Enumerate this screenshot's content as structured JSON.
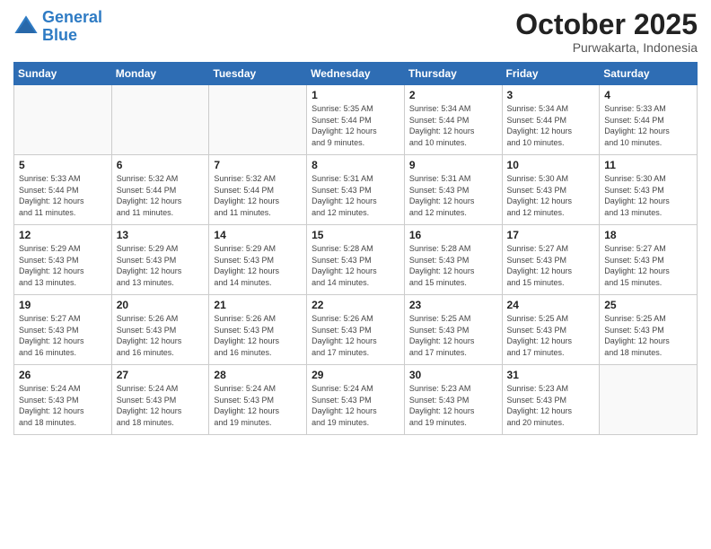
{
  "header": {
    "logo_line1": "General",
    "logo_line2": "Blue",
    "month": "October 2025",
    "location": "Purwakarta, Indonesia"
  },
  "weekdays": [
    "Sunday",
    "Monday",
    "Tuesday",
    "Wednesday",
    "Thursday",
    "Friday",
    "Saturday"
  ],
  "weeks": [
    [
      {
        "day": "",
        "info": ""
      },
      {
        "day": "",
        "info": ""
      },
      {
        "day": "",
        "info": ""
      },
      {
        "day": "1",
        "info": "Sunrise: 5:35 AM\nSunset: 5:44 PM\nDaylight: 12 hours\nand 9 minutes."
      },
      {
        "day": "2",
        "info": "Sunrise: 5:34 AM\nSunset: 5:44 PM\nDaylight: 12 hours\nand 10 minutes."
      },
      {
        "day": "3",
        "info": "Sunrise: 5:34 AM\nSunset: 5:44 PM\nDaylight: 12 hours\nand 10 minutes."
      },
      {
        "day": "4",
        "info": "Sunrise: 5:33 AM\nSunset: 5:44 PM\nDaylight: 12 hours\nand 10 minutes."
      }
    ],
    [
      {
        "day": "5",
        "info": "Sunrise: 5:33 AM\nSunset: 5:44 PM\nDaylight: 12 hours\nand 11 minutes."
      },
      {
        "day": "6",
        "info": "Sunrise: 5:32 AM\nSunset: 5:44 PM\nDaylight: 12 hours\nand 11 minutes."
      },
      {
        "day": "7",
        "info": "Sunrise: 5:32 AM\nSunset: 5:44 PM\nDaylight: 12 hours\nand 11 minutes."
      },
      {
        "day": "8",
        "info": "Sunrise: 5:31 AM\nSunset: 5:43 PM\nDaylight: 12 hours\nand 12 minutes."
      },
      {
        "day": "9",
        "info": "Sunrise: 5:31 AM\nSunset: 5:43 PM\nDaylight: 12 hours\nand 12 minutes."
      },
      {
        "day": "10",
        "info": "Sunrise: 5:30 AM\nSunset: 5:43 PM\nDaylight: 12 hours\nand 12 minutes."
      },
      {
        "day": "11",
        "info": "Sunrise: 5:30 AM\nSunset: 5:43 PM\nDaylight: 12 hours\nand 13 minutes."
      }
    ],
    [
      {
        "day": "12",
        "info": "Sunrise: 5:29 AM\nSunset: 5:43 PM\nDaylight: 12 hours\nand 13 minutes."
      },
      {
        "day": "13",
        "info": "Sunrise: 5:29 AM\nSunset: 5:43 PM\nDaylight: 12 hours\nand 13 minutes."
      },
      {
        "day": "14",
        "info": "Sunrise: 5:29 AM\nSunset: 5:43 PM\nDaylight: 12 hours\nand 14 minutes."
      },
      {
        "day": "15",
        "info": "Sunrise: 5:28 AM\nSunset: 5:43 PM\nDaylight: 12 hours\nand 14 minutes."
      },
      {
        "day": "16",
        "info": "Sunrise: 5:28 AM\nSunset: 5:43 PM\nDaylight: 12 hours\nand 15 minutes."
      },
      {
        "day": "17",
        "info": "Sunrise: 5:27 AM\nSunset: 5:43 PM\nDaylight: 12 hours\nand 15 minutes."
      },
      {
        "day": "18",
        "info": "Sunrise: 5:27 AM\nSunset: 5:43 PM\nDaylight: 12 hours\nand 15 minutes."
      }
    ],
    [
      {
        "day": "19",
        "info": "Sunrise: 5:27 AM\nSunset: 5:43 PM\nDaylight: 12 hours\nand 16 minutes."
      },
      {
        "day": "20",
        "info": "Sunrise: 5:26 AM\nSunset: 5:43 PM\nDaylight: 12 hours\nand 16 minutes."
      },
      {
        "day": "21",
        "info": "Sunrise: 5:26 AM\nSunset: 5:43 PM\nDaylight: 12 hours\nand 16 minutes."
      },
      {
        "day": "22",
        "info": "Sunrise: 5:26 AM\nSunset: 5:43 PM\nDaylight: 12 hours\nand 17 minutes."
      },
      {
        "day": "23",
        "info": "Sunrise: 5:25 AM\nSunset: 5:43 PM\nDaylight: 12 hours\nand 17 minutes."
      },
      {
        "day": "24",
        "info": "Sunrise: 5:25 AM\nSunset: 5:43 PM\nDaylight: 12 hours\nand 17 minutes."
      },
      {
        "day": "25",
        "info": "Sunrise: 5:25 AM\nSunset: 5:43 PM\nDaylight: 12 hours\nand 18 minutes."
      }
    ],
    [
      {
        "day": "26",
        "info": "Sunrise: 5:24 AM\nSunset: 5:43 PM\nDaylight: 12 hours\nand 18 minutes."
      },
      {
        "day": "27",
        "info": "Sunrise: 5:24 AM\nSunset: 5:43 PM\nDaylight: 12 hours\nand 18 minutes."
      },
      {
        "day": "28",
        "info": "Sunrise: 5:24 AM\nSunset: 5:43 PM\nDaylight: 12 hours\nand 19 minutes."
      },
      {
        "day": "29",
        "info": "Sunrise: 5:24 AM\nSunset: 5:43 PM\nDaylight: 12 hours\nand 19 minutes."
      },
      {
        "day": "30",
        "info": "Sunrise: 5:23 AM\nSunset: 5:43 PM\nDaylight: 12 hours\nand 19 minutes."
      },
      {
        "day": "31",
        "info": "Sunrise: 5:23 AM\nSunset: 5:43 PM\nDaylight: 12 hours\nand 20 minutes."
      },
      {
        "day": "",
        "info": ""
      }
    ]
  ]
}
